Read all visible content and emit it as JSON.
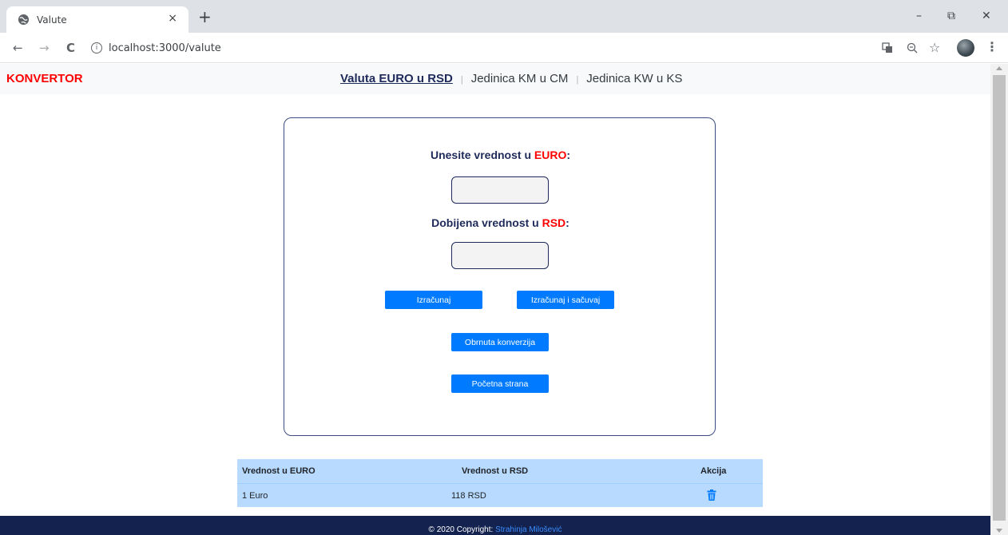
{
  "browser": {
    "tab_title": "Valute",
    "tab_close": "×",
    "new_tab": "+",
    "minimize": "–",
    "restore": "⧉",
    "close_window": "✕",
    "back": "←",
    "forward": "→",
    "reload": "C",
    "url": "localhost:3000/valute",
    "icons": [
      "translate-icon",
      "zoom-icon",
      "star-icon",
      "profile-avatar",
      "menu-icon"
    ]
  },
  "navbar": {
    "brand": "KONVERTOR",
    "links": [
      {
        "label": "Valuta EURO u RSD",
        "active": true
      },
      {
        "label": "Jedinica KM u CM",
        "active": false
      },
      {
        "label": "Jedinica KW u KS",
        "active": false
      }
    ],
    "separator": "|"
  },
  "form": {
    "input_label_prefix": "Unesite vrednost u ",
    "input_label_highlight": "EURO",
    "input_label_suffix": ":",
    "input_value": "",
    "output_label_prefix": "Dobijena vrednost u ",
    "output_label_highlight": "RSD",
    "output_label_suffix": ":",
    "output_value": "",
    "btn_calculate": "Izračunaj",
    "btn_calculate_save": "Izračunaj i sačuvaj",
    "btn_reverse": "Obrnuta konverzija",
    "btn_home": "Početna strana"
  },
  "table": {
    "headers": [
      "Vrednost u EURO",
      "Vrednost u RSD",
      "Akcija"
    ],
    "rows": [
      {
        "euro": "1 Euro",
        "rsd": "118 RSD",
        "action_icon": "trash-icon"
      }
    ]
  },
  "footer": {
    "text": "© 2020 Copyright: ",
    "author": "Strahinja Milošević"
  },
  "colors": {
    "brand": "#ff0000",
    "primary_button": "#007bff",
    "table_bg": "#b8daff",
    "footer_bg": "#14224f",
    "footer_link": "#3a8cff",
    "label_text": "#1e2a5a"
  }
}
